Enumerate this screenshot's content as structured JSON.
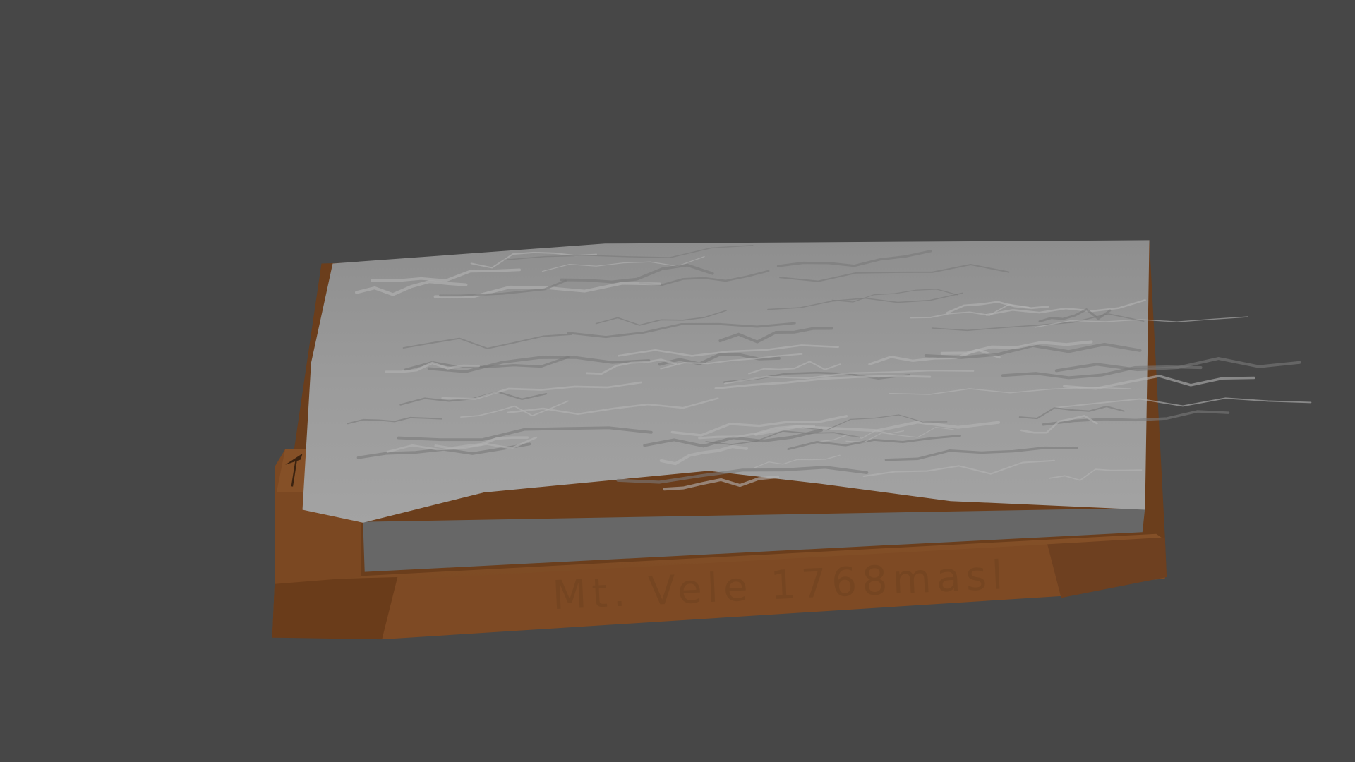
{
  "scene": {
    "background_color": "#474747",
    "terrain_color": "#9a9a9a",
    "terrain_side_color": "#6a6a6a",
    "base_color": "#7a4a24",
    "base_dark_color": "#5e3519"
  },
  "base_label": "Mt. Vele 1768masl"
}
